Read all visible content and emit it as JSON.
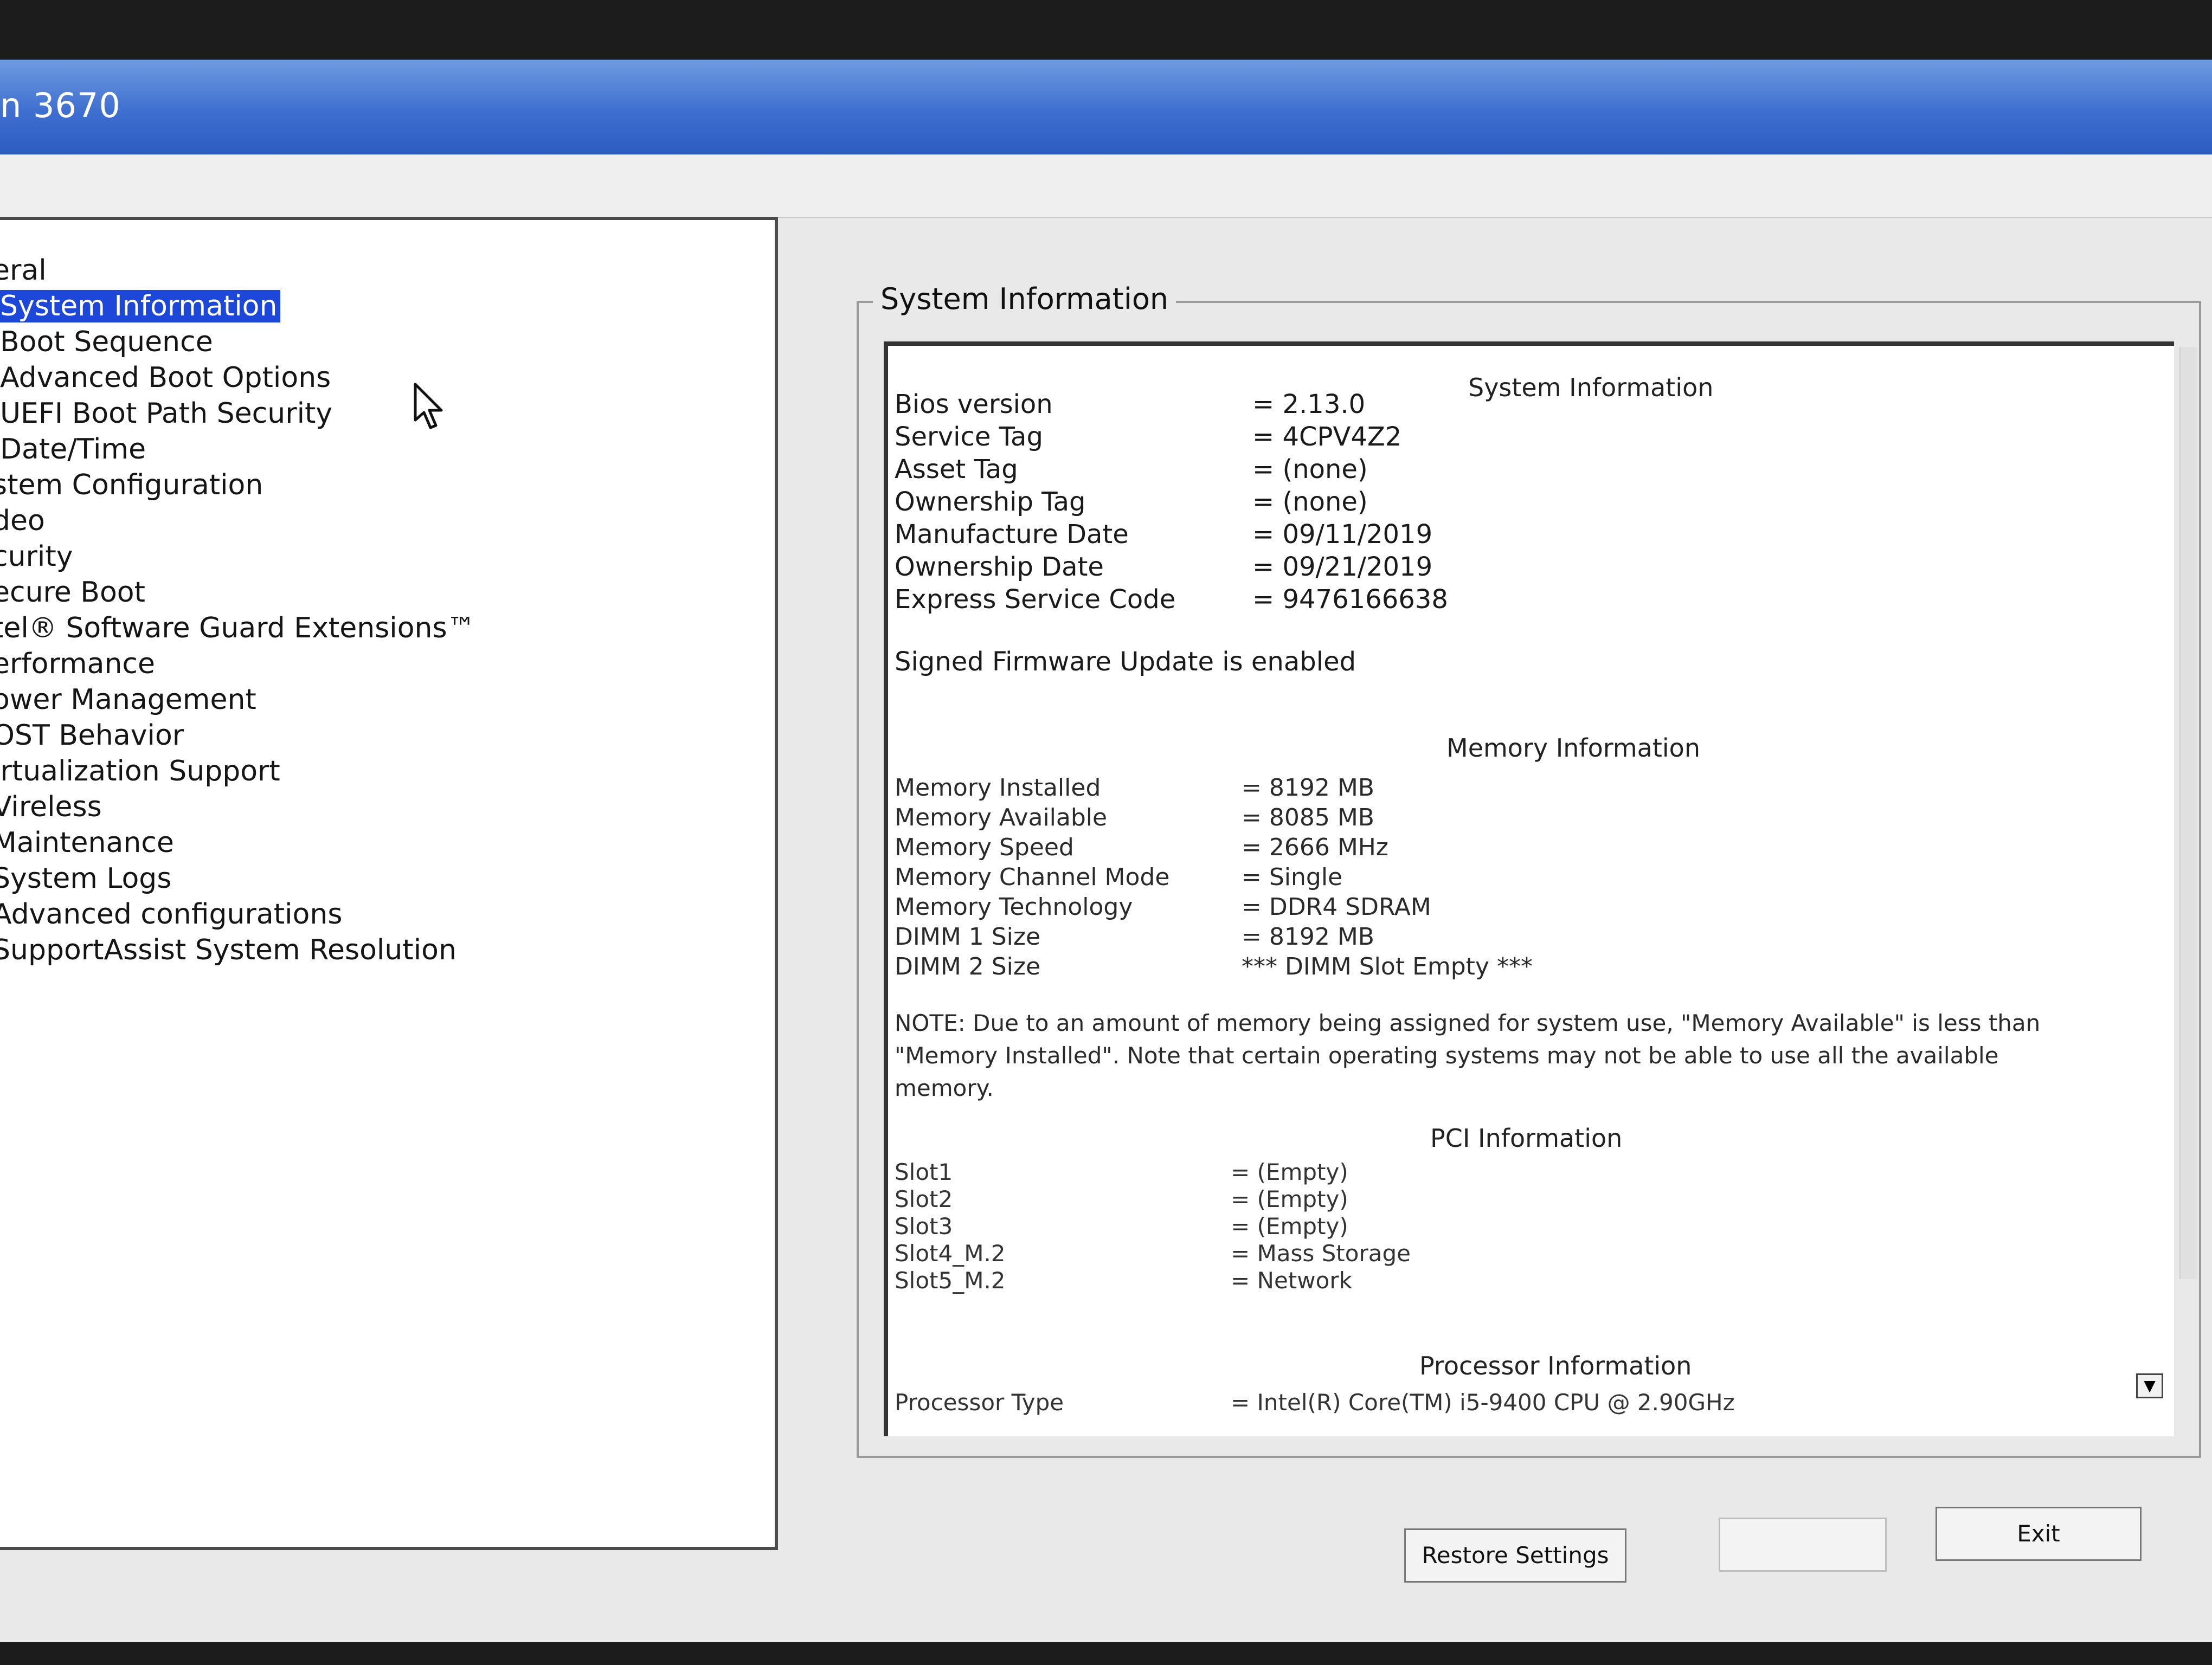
{
  "window": {
    "title": "n 3670"
  },
  "nav": {
    "items": [
      {
        "label": "eral",
        "level": 0
      },
      {
        "label": "System Information",
        "level": 1,
        "selected": true
      },
      {
        "label": "Boot Sequence",
        "level": 1
      },
      {
        "label": "Advanced Boot Options",
        "level": 1
      },
      {
        "label": "UEFI Boot Path Security",
        "level": 1
      },
      {
        "label": "Date/Time",
        "level": 1
      },
      {
        "label": "stem Configuration",
        "level": 0
      },
      {
        "label": "deo",
        "level": 0
      },
      {
        "label": "curity",
        "level": 0
      },
      {
        "label": "ecure Boot",
        "level": 0
      },
      {
        "label": "tel® Software Guard Extensions™",
        "level": 0
      },
      {
        "label": "erformance",
        "level": 0
      },
      {
        "label": "ower Management",
        "level": 0
      },
      {
        "label": "OST Behavior",
        "level": 0
      },
      {
        "label": "irtualization Support",
        "level": 0
      },
      {
        "label": "Vireless",
        "level": 0
      },
      {
        "label": "Maintenance",
        "level": 0
      },
      {
        "label": "System Logs",
        "level": 0
      },
      {
        "label": "Advanced configurations",
        "level": 0
      },
      {
        "label": "SupportAssist System Resolution",
        "level": 0
      }
    ]
  },
  "panel": {
    "group_title": "System Information",
    "system": {
      "heading": "System Information",
      "rows": [
        {
          "key": "Bios version",
          "value": "= 2.13.0"
        },
        {
          "key": "Service Tag",
          "value": "= 4CPV4Z2"
        },
        {
          "key": "Asset Tag",
          "value": "= (none)"
        },
        {
          "key": "Ownership Tag",
          "value": "= (none)"
        },
        {
          "key": "Manufacture Date",
          "value": "= 09/11/2019"
        },
        {
          "key": "Ownership Date",
          "value": "= 09/21/2019"
        },
        {
          "key": "Express Service Code",
          "value": "= 9476166638"
        }
      ],
      "firmware_note": "Signed Firmware Update is enabled"
    },
    "memory": {
      "heading": "Memory Information",
      "rows": [
        {
          "key": "Memory Installed",
          "value": "= 8192 MB"
        },
        {
          "key": "Memory Available",
          "value": "= 8085 MB"
        },
        {
          "key": "Memory Speed",
          "value": "= 2666 MHz"
        },
        {
          "key": "Memory Channel Mode",
          "value": "= Single"
        },
        {
          "key": "Memory Technology",
          "value": "= DDR4 SDRAM"
        },
        {
          "key": "DIMM 1 Size",
          "value": "= 8192 MB"
        },
        {
          "key": "DIMM 2 Size",
          "value": "*** DIMM Slot Empty ***"
        }
      ],
      "note": "NOTE: Due to an amount of memory being assigned for system use, \"Memory Available\" is less than \"Memory Installed\". Note that certain operating systems may not be able to use all the available memory."
    },
    "pci": {
      "heading": "PCI Information",
      "rows": [
        {
          "key": "Slot1",
          "value": "= (Empty)"
        },
        {
          "key": "Slot2",
          "value": "= (Empty)"
        },
        {
          "key": "Slot3",
          "value": "= (Empty)"
        },
        {
          "key": "Slot4_M.2",
          "value": "= Mass Storage"
        },
        {
          "key": "Slot5_M.2",
          "value": "= Network"
        }
      ]
    },
    "processor": {
      "heading": "Processor Information",
      "rows": [
        {
          "key": "Processor Type",
          "value": "= Intel(R) Core(TM) i5-9400 CPU @ 2.90GHz"
        }
      ]
    }
  },
  "buttons": {
    "restore_label": "Restore Settings",
    "apply_label": "",
    "exit_label": "Exit"
  },
  "colors": {
    "selection": "#1c47d8",
    "titlebar": "#3e6fd0"
  }
}
